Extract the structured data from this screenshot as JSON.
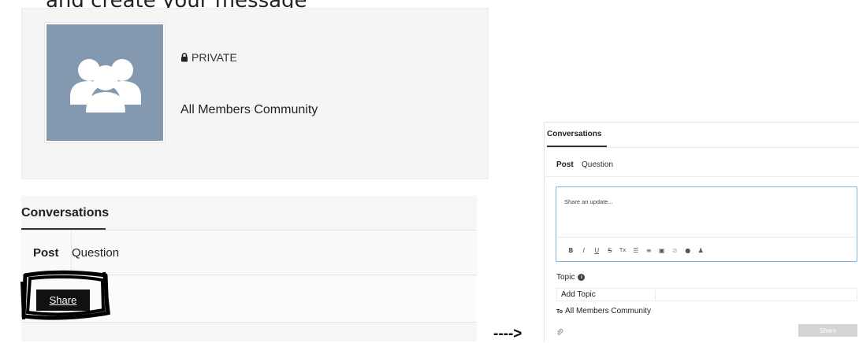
{
  "caption": "and create your message",
  "group": {
    "privacy_label": "PRIVATE",
    "name": "All Members Community",
    "avatar_icon": "people-group-icon",
    "avatar_color": "#8299b0"
  },
  "left_conversations": {
    "title": "Conversations",
    "tabs": [
      {
        "label": "Post",
        "active": true
      },
      {
        "label": "Question",
        "active": false
      }
    ],
    "share_label": "Share"
  },
  "arrow_text": "---->",
  "right_conversations": {
    "title": "Conversations",
    "tabs": [
      {
        "label": "Post",
        "active": true
      },
      {
        "label": "Question",
        "active": false
      }
    ],
    "editor_placeholder": "Share an update...",
    "toolbar": [
      {
        "icon": "bold-icon",
        "glyph": "B"
      },
      {
        "icon": "italic-icon",
        "glyph": "I"
      },
      {
        "icon": "underline-icon",
        "glyph": "U"
      },
      {
        "icon": "strikethrough-icon",
        "glyph": "S"
      },
      {
        "icon": "clear-format-icon",
        "glyph": "Tx"
      },
      {
        "icon": "bullet-list-icon",
        "glyph": "☰"
      },
      {
        "icon": "numbered-list-icon",
        "glyph": "≡"
      },
      {
        "icon": "image-icon",
        "glyph": "▣"
      },
      {
        "icon": "link-icon",
        "glyph": "⊘"
      },
      {
        "icon": "emoji-icon",
        "glyph": "●"
      },
      {
        "icon": "mention-icon",
        "glyph": "♟"
      }
    ],
    "topic_label": "Topic",
    "add_topic_placeholder": "Add Topic",
    "to_prefix": "To",
    "to_value": "All Members Community",
    "share_label": "Share",
    "accent_color": "#7fb2e0"
  }
}
